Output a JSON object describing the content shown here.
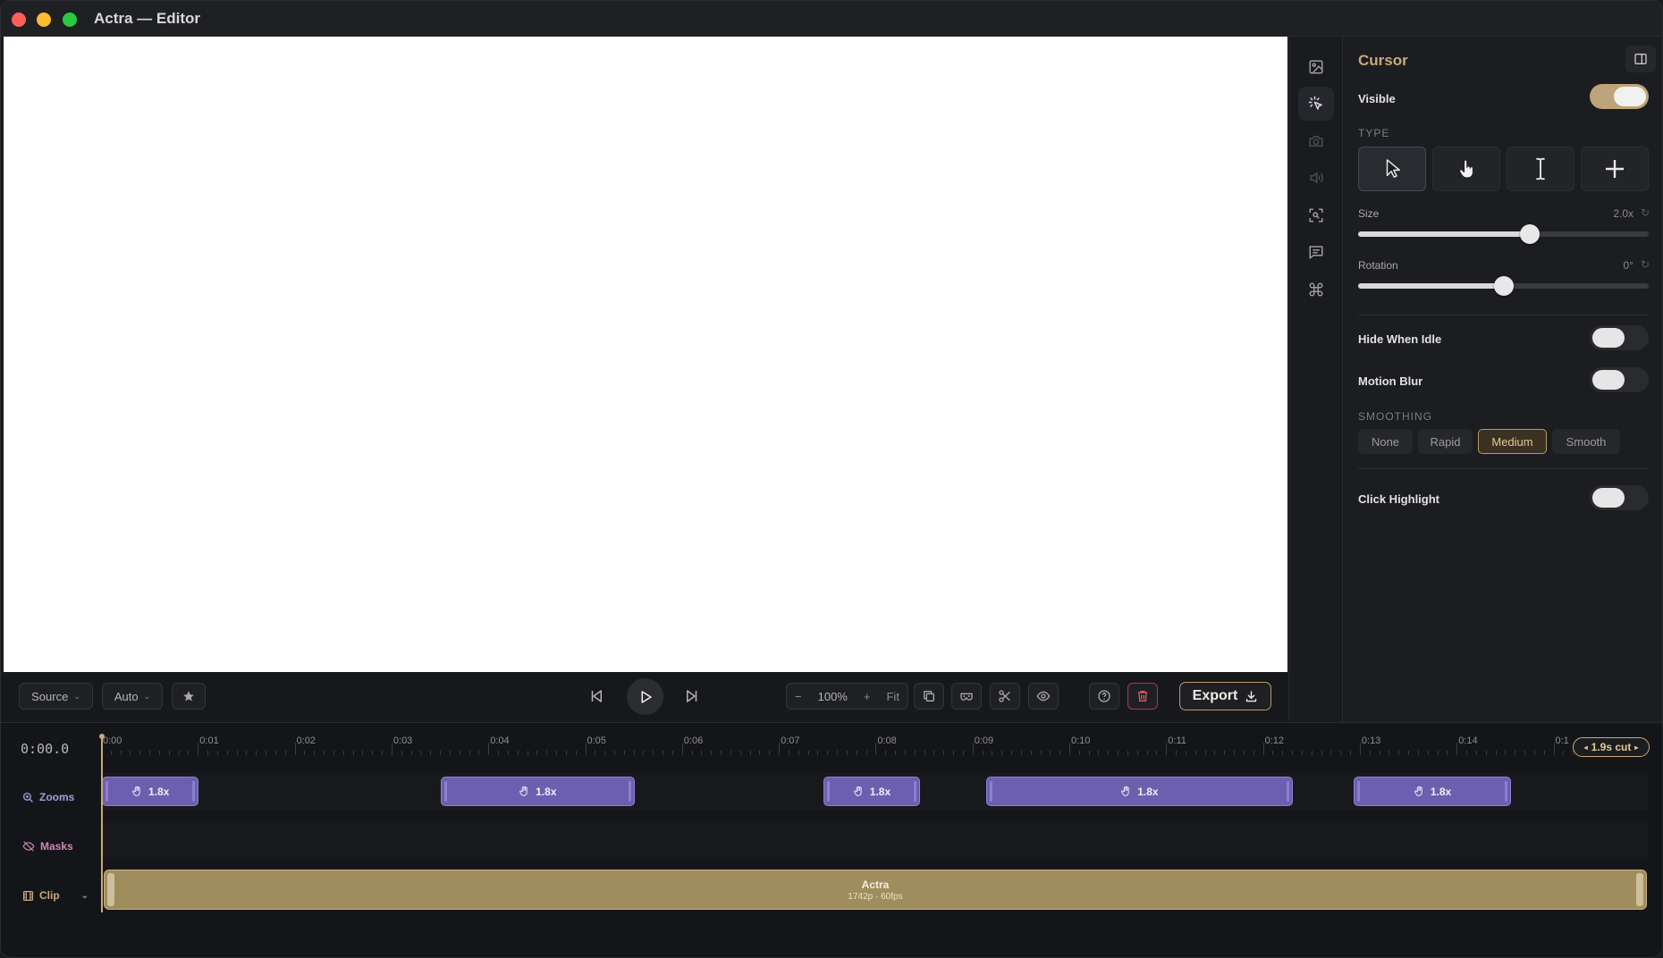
{
  "window": {
    "title": "Actra — Editor"
  },
  "toolbar": {
    "source_label": "Source",
    "auto_label": "Auto",
    "zoom_percent": "100%",
    "zoom_minus": "−",
    "zoom_plus": "+",
    "fit_label": "Fit",
    "export_label": "Export"
  },
  "panel": {
    "title": "Cursor",
    "visible_label": "Visible",
    "visible_on": true,
    "type_label": "TYPE",
    "type_options": [
      "arrow-pointer",
      "hand-pointer",
      "text-beam",
      "crosshair"
    ],
    "type_selected": "arrow-pointer",
    "size_label": "Size",
    "size_value": "2.0x",
    "size_fraction": 0.59,
    "rotation_label": "Rotation",
    "rotation_value": "0°",
    "rotation_fraction": 0.5,
    "hide_idle_label": "Hide When Idle",
    "hide_idle_on": false,
    "motion_blur_label": "Motion Blur",
    "motion_blur_on": false,
    "smoothing_label": "SMOOTHING",
    "smoothing_options": [
      "None",
      "Rapid",
      "Medium",
      "Smooth"
    ],
    "smoothing_selected": "Medium",
    "click_highlight_label": "Click Highlight",
    "click_highlight_on": false
  },
  "timeline": {
    "timecode": "0:00.0",
    "ticks": [
      "0:00",
      "0:01",
      "0:02",
      "0:03",
      "0:04",
      "0:05",
      "0:06",
      "0:07",
      "0:08",
      "0:09",
      "0:10",
      "0:11",
      "0:12",
      "0:13",
      "0:14",
      "0:1"
    ],
    "cut_badge": "1.9s cut",
    "tracks": {
      "zooms_label": "Zooms",
      "masks_label": "Masks",
      "clip_label": "Clip"
    },
    "zoom_segments": [
      {
        "label": "1.8x",
        "start": 0.0,
        "end": 1.0
      },
      {
        "label": "1.8x",
        "start": 3.5,
        "end": 5.5
      },
      {
        "label": "1.8x",
        "start": 7.45,
        "end": 8.45
      },
      {
        "label": "1.8x",
        "start": 9.13,
        "end": 12.3
      },
      {
        "label": "1.8x",
        "start": 12.93,
        "end": 14.55
      }
    ],
    "clip": {
      "name": "Actra",
      "meta": "1742p · 60fps"
    }
  },
  "colors": {
    "accent": "#c9a97c",
    "zoom_segment": "#6d5fb0",
    "clip": "#a08d5e",
    "delete": "#e05a5a"
  }
}
